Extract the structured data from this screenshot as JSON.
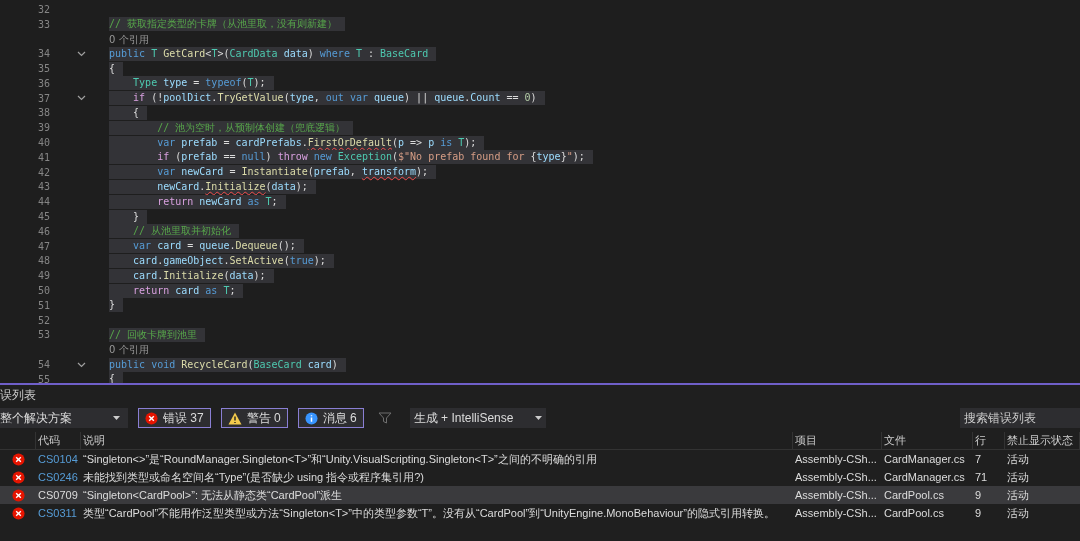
{
  "editor": {
    "lines": [
      {
        "number": "32",
        "fold": false
      },
      {
        "number": "33",
        "fold": false,
        "tokens": [
          {
            "kind": "comment",
            "text": "// 获取指定类型的卡牌（从池里取，没有则新建）"
          }
        ]
      },
      {
        "fold": false,
        "lens": "0 个引用"
      },
      {
        "number": "34",
        "fold": true,
        "tokens": [
          {
            "kind": "keyword",
            "text": "public "
          },
          {
            "kind": "type",
            "text": "T "
          },
          {
            "kind": "method",
            "text": "GetCard"
          },
          {
            "kind": "plain",
            "text": "<"
          },
          {
            "kind": "type",
            "text": "T"
          },
          {
            "kind": "plain",
            "text": ">("
          },
          {
            "kind": "type",
            "text": "CardData "
          },
          {
            "kind": "variable",
            "text": "data"
          },
          {
            "kind": "plain",
            "text": ") "
          },
          {
            "kind": "keyword",
            "text": "where "
          },
          {
            "kind": "type",
            "text": "T"
          },
          {
            "kind": "plain",
            "text": " : "
          },
          {
            "kind": "type",
            "text": "BaseCard"
          }
        ]
      },
      {
        "number": "35",
        "fold": false,
        "tokens": [
          {
            "kind": "plain",
            "text": "{"
          }
        ]
      },
      {
        "number": "36",
        "fold": false,
        "tokens": [
          {
            "kind": "type",
            "text": "    Type "
          },
          {
            "kind": "variable",
            "text": "type"
          },
          {
            "kind": "plain",
            "text": " = "
          },
          {
            "kind": "keyword",
            "text": "typeof"
          },
          {
            "kind": "plain",
            "text": "("
          },
          {
            "kind": "type",
            "text": "T"
          },
          {
            "kind": "plain",
            "text": ");"
          }
        ]
      },
      {
        "number": "37",
        "fold": true,
        "tokens": [
          {
            "kind": "control",
            "text": "    if"
          },
          {
            "kind": "plain",
            "text": " (!"
          },
          {
            "kind": "variable",
            "text": "poolDict"
          },
          {
            "kind": "plain",
            "text": "."
          },
          {
            "kind": "method",
            "text": "TryGetValue"
          },
          {
            "kind": "plain",
            "text": "("
          },
          {
            "kind": "variable",
            "text": "type"
          },
          {
            "kind": "plain",
            "text": ", "
          },
          {
            "kind": "keyword",
            "text": "out var "
          },
          {
            "kind": "variable",
            "text": "queue"
          },
          {
            "kind": "plain",
            "text": ") || "
          },
          {
            "kind": "variable",
            "text": "queue"
          },
          {
            "kind": "plain",
            "text": "."
          },
          {
            "kind": "variable",
            "text": "Count"
          },
          {
            "kind": "plain",
            "text": " == "
          },
          {
            "kind": "number",
            "text": "0"
          },
          {
            "kind": "plain",
            "text": ")"
          }
        ]
      },
      {
        "number": "38",
        "fold": false,
        "tokens": [
          {
            "kind": "plain",
            "text": "    {"
          }
        ]
      },
      {
        "number": "39",
        "fold": false,
        "tokens": [
          {
            "kind": "comment",
            "text": "        // 池为空时，从预制体创建（兜底逻辑）"
          }
        ]
      },
      {
        "number": "40",
        "fold": false,
        "tokens": [
          {
            "kind": "keyword",
            "text": "        var "
          },
          {
            "kind": "variable",
            "text": "prefab"
          },
          {
            "kind": "plain",
            "text": " = "
          },
          {
            "kind": "variable",
            "text": "cardPrefabs"
          },
          {
            "kind": "plain",
            "text": "."
          },
          {
            "kind": "method",
            "text": "FirstOrDefault",
            "error": true
          },
          {
            "kind": "plain",
            "text": "("
          },
          {
            "kind": "variable",
            "text": "p"
          },
          {
            "kind": "plain",
            "text": " => "
          },
          {
            "kind": "variable",
            "text": "p "
          },
          {
            "kind": "keyword",
            "text": "is "
          },
          {
            "kind": "type",
            "text": "T"
          },
          {
            "kind": "plain",
            "text": ");"
          }
        ]
      },
      {
        "number": "41",
        "fold": false,
        "tokens": [
          {
            "kind": "control",
            "text": "        if"
          },
          {
            "kind": "plain",
            "text": " ("
          },
          {
            "kind": "variable",
            "text": "prefab"
          },
          {
            "kind": "plain",
            "text": " == "
          },
          {
            "kind": "keyword",
            "text": "null"
          },
          {
            "kind": "plain",
            "text": ") "
          },
          {
            "kind": "control",
            "text": "throw "
          },
          {
            "kind": "keyword",
            "text": "new "
          },
          {
            "kind": "type",
            "text": "Exception"
          },
          {
            "kind": "plain",
            "text": "("
          },
          {
            "kind": "string",
            "text": "$\"No prefab found for "
          },
          {
            "kind": "plain",
            "text": "{"
          },
          {
            "kind": "variable",
            "text": "type"
          },
          {
            "kind": "plain",
            "text": "}"
          },
          {
            "kind": "string",
            "text": "\""
          },
          {
            "kind": "plain",
            "text": ");"
          }
        ]
      },
      {
        "number": "42",
        "fold": false,
        "tokens": [
          {
            "kind": "keyword",
            "text": "        var "
          },
          {
            "kind": "variable",
            "text": "newCard"
          },
          {
            "kind": "plain",
            "text": " = "
          },
          {
            "kind": "method",
            "text": "Instantiate"
          },
          {
            "kind": "plain",
            "text": "("
          },
          {
            "kind": "variable",
            "text": "prefab"
          },
          {
            "kind": "plain",
            "text": ", "
          },
          {
            "kind": "variable",
            "text": "transform",
            "error": true
          },
          {
            "kind": "plain",
            "text": ");"
          }
        ]
      },
      {
        "number": "43",
        "fold": false,
        "tokens": [
          {
            "kind": "variable",
            "text": "        newCard"
          },
          {
            "kind": "plain",
            "text": "."
          },
          {
            "kind": "method",
            "text": "Initialize",
            "error": true
          },
          {
            "kind": "plain",
            "text": "("
          },
          {
            "kind": "variable",
            "text": "data"
          },
          {
            "kind": "plain",
            "text": ");"
          }
        ]
      },
      {
        "number": "44",
        "fold": false,
        "tokens": [
          {
            "kind": "control",
            "text": "        return "
          },
          {
            "kind": "variable",
            "text": "newCard "
          },
          {
            "kind": "keyword",
            "text": "as "
          },
          {
            "kind": "type",
            "text": "T"
          },
          {
            "kind": "plain",
            "text": ";"
          }
        ]
      },
      {
        "number": "45",
        "fold": false,
        "tokens": [
          {
            "kind": "plain",
            "text": "    }"
          }
        ]
      },
      {
        "number": "46",
        "fold": false,
        "tokens": [
          {
            "kind": "comment",
            "text": "    // 从池里取并初始化"
          }
        ]
      },
      {
        "number": "47",
        "fold": false,
        "tokens": [
          {
            "kind": "keyword",
            "text": "    var "
          },
          {
            "kind": "variable",
            "text": "card"
          },
          {
            "kind": "plain",
            "text": " = "
          },
          {
            "kind": "variable",
            "text": "queue"
          },
          {
            "kind": "plain",
            "text": "."
          },
          {
            "kind": "method",
            "text": "Dequeue"
          },
          {
            "kind": "plain",
            "text": "();"
          }
        ]
      },
      {
        "number": "48",
        "fold": false,
        "tokens": [
          {
            "kind": "variable",
            "text": "    card"
          },
          {
            "kind": "plain",
            "text": "."
          },
          {
            "kind": "variable",
            "text": "gameObject"
          },
          {
            "kind": "plain",
            "text": "."
          },
          {
            "kind": "method",
            "text": "SetActive"
          },
          {
            "kind": "plain",
            "text": "("
          },
          {
            "kind": "keyword",
            "text": "true"
          },
          {
            "kind": "plain",
            "text": ");"
          }
        ]
      },
      {
        "number": "49",
        "fold": false,
        "tokens": [
          {
            "kind": "variable",
            "text": "    card"
          },
          {
            "kind": "plain",
            "text": "."
          },
          {
            "kind": "method",
            "text": "Initialize"
          },
          {
            "kind": "plain",
            "text": "("
          },
          {
            "kind": "variable",
            "text": "data"
          },
          {
            "kind": "plain",
            "text": ");"
          }
        ]
      },
      {
        "number": "50",
        "fold": false,
        "tokens": [
          {
            "kind": "control",
            "text": "    return "
          },
          {
            "kind": "variable",
            "text": "card "
          },
          {
            "kind": "keyword",
            "text": "as "
          },
          {
            "kind": "type",
            "text": "T"
          },
          {
            "kind": "plain",
            "text": ";"
          }
        ]
      },
      {
        "number": "51",
        "fold": false,
        "tokens": [
          {
            "kind": "plain",
            "text": "}"
          }
        ]
      },
      {
        "number": "52",
        "fold": false
      },
      {
        "number": "53",
        "fold": false,
        "tokens": [
          {
            "kind": "comment",
            "text": "// 回收卡牌到池里"
          }
        ]
      },
      {
        "fold": false,
        "lens": "0 个引用"
      },
      {
        "number": "54",
        "fold": true,
        "tokens": [
          {
            "kind": "keyword",
            "text": "public void "
          },
          {
            "kind": "method",
            "text": "RecycleCard"
          },
          {
            "kind": "plain",
            "text": "("
          },
          {
            "kind": "type",
            "text": "BaseCard "
          },
          {
            "kind": "variable",
            "text": "card"
          },
          {
            "kind": "plain",
            "text": ")"
          }
        ]
      },
      {
        "number": "55",
        "fold": false,
        "tokens": [
          {
            "kind": "plain",
            "text": "{"
          }
        ]
      }
    ]
  },
  "error_list": {
    "title": "误列表",
    "scope": "整个解决方案",
    "filters": [
      {
        "kind": "error",
        "label": "错误 37",
        "selected": true
      },
      {
        "kind": "warning",
        "label": "警告 0",
        "selected": true
      },
      {
        "kind": "info",
        "label": "消息 6",
        "selected": true
      }
    ],
    "source": "生成 + IntelliSense",
    "search": {
      "placeholder": "搜索错误列表"
    },
    "columns": [
      "代码",
      "说明",
      "项目",
      "文件",
      "行",
      "禁止显示状态"
    ],
    "rows": [
      {
        "code": "CS0104",
        "description": "“Singleton<>”是“RoundManager.Singleton<T>”和“Unity.VisualScripting.Singleton<T>”之间的不明确的引用",
        "project": "Assembly-CSh...",
        "file": "CardManager.cs",
        "line": "7",
        "state": "活动",
        "selected": false
      },
      {
        "code": "CS0246",
        "description": "未能找到类型或命名空间名“Type”(是否缺少 using 指令或程序集引用?)",
        "project": "Assembly-CSh...",
        "file": "CardManager.cs",
        "line": "71",
        "state": "活动",
        "selected": false
      },
      {
        "code": "CS0709",
        "description": "“Singleton<CardPool>”: 无法从静态类“CardPool”派生",
        "project": "Assembly-CSh...",
        "file": "CardPool.cs",
        "line": "9",
        "state": "活动",
        "selected": true
      },
      {
        "code": "CS0311",
        "description": "类型“CardPool”不能用作泛型类型或方法“Singleton<T>”中的类型参数“T”。没有从“CardPool”到“UnityEngine.MonoBehaviour”的隐式引用转换。",
        "project": "Assembly-CSh...",
        "file": "CardPool.cs",
        "line": "9",
        "state": "活动",
        "selected": false
      }
    ]
  }
}
